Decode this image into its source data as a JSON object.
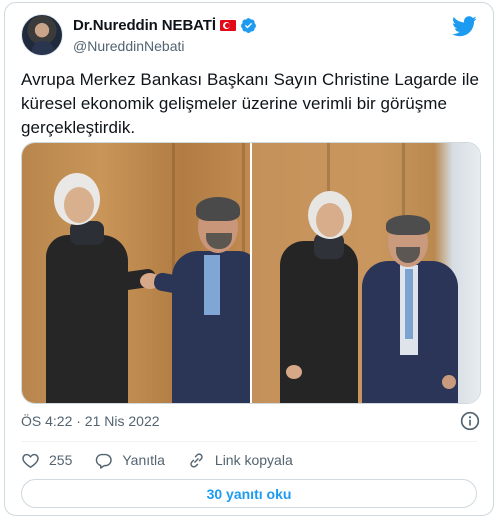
{
  "author": {
    "display_name": "Dr.Nureddin NEBATİ",
    "handle": "@NureddinNebati",
    "flag": "turkey-flag-icon",
    "verified": true
  },
  "tweet": {
    "text": "Avrupa Merkez Bankası Başkanı Sayın Christine Lagarde ile küresel ekonomik gelişmeler üzerine verimli bir görüşme gerçekleştirdik."
  },
  "meta": {
    "timestamp": "ÖS 4:22 · 21 Nis 2022"
  },
  "actions": {
    "like_count": "255",
    "reply_label": "Yanıtla",
    "copy_link_label": "Link kopyala"
  },
  "footer": {
    "read_replies_label": "30 yanıtı oku"
  },
  "colors": {
    "accent": "#1d9bf0",
    "text_secondary": "#536471",
    "border": "#cfd9de"
  },
  "icons": [
    "twitter-bird-icon",
    "verified-badge-icon",
    "info-icon",
    "heart-icon",
    "reply-icon",
    "link-icon"
  ]
}
